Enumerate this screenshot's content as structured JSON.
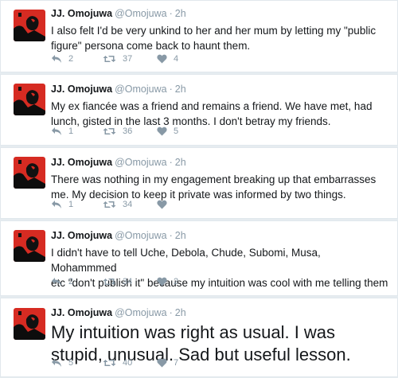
{
  "account": {
    "name": "JJ. Omojuwa",
    "handle": "@Omojuwa",
    "separator": "·",
    "avatar_icon": "profile-photo-red-black"
  },
  "colors": {
    "muted": "#8899a6",
    "avatar_red": "#d62b22",
    "border": "#e1e8ed"
  },
  "tweets": [
    {
      "time": "2h",
      "text": "I also felt I'd be very unkind to her and her mum by letting my \"public\nfigure\" persona come back to haunt them.",
      "replies": "2",
      "retweets": "37",
      "likes": "4"
    },
    {
      "time": "2h",
      "text": "My ex fiancée was a friend and remains a friend. We have met, had\nlunch, gisted in the last 3 months. I don't betray my friends.",
      "replies": "1",
      "retweets": "36",
      "likes": "5"
    },
    {
      "time": "2h",
      "text": "There was nothing in my engagement breaking up that embarrasses\nme. My decision to keep it private was informed by two things.",
      "replies": "1",
      "retweets": "34",
      "likes": ""
    },
    {
      "time": "2h",
      "text": "I didn't have to tell Uche, Debola, Chude, Subomi, Musa, Mohammmed\netc \"don't publish it\" because my intuition was cool with me telling them",
      "replies": "2",
      "retweets": "34",
      "likes": "2"
    },
    {
      "time": "2h",
      "text": "My intuition was right as usual. I was\nstupid, unusual. Sad but useful lesson.",
      "replies": "5",
      "retweets": "40",
      "likes": "7"
    }
  ]
}
